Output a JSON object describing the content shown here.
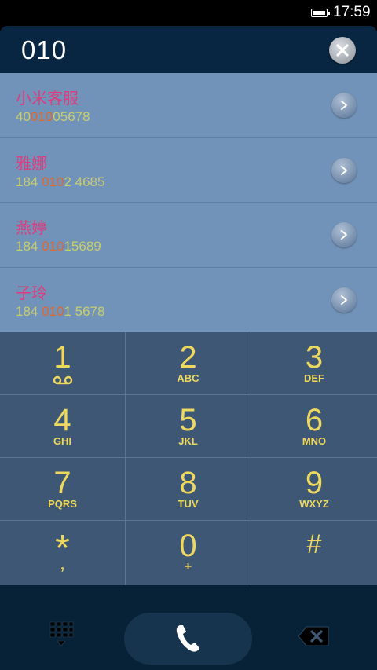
{
  "status_bar": {
    "time": "17:59"
  },
  "search": {
    "query": "010"
  },
  "results": [
    {
      "name": "小米客服",
      "number_parts": [
        "40",
        "010",
        "05678"
      ]
    },
    {
      "name": "雅娜",
      "number_parts": [
        "184 ",
        "010",
        "2 4685"
      ]
    },
    {
      "name": "燕婷",
      "number_parts": [
        "184 ",
        "010",
        "15689"
      ]
    },
    {
      "name": "子玲",
      "number_parts": [
        "184 ",
        "010",
        "1 5678"
      ]
    }
  ],
  "keypad": [
    {
      "digit": "1",
      "sub": "voicemail-icon"
    },
    {
      "digit": "2",
      "sub": "ABC"
    },
    {
      "digit": "3",
      "sub": "DEF"
    },
    {
      "digit": "4",
      "sub": "GHI"
    },
    {
      "digit": "5",
      "sub": "JKL"
    },
    {
      "digit": "6",
      "sub": "MNO"
    },
    {
      "digit": "7",
      "sub": "PQRS"
    },
    {
      "digit": "8",
      "sub": "TUV"
    },
    {
      "digit": "9",
      "sub": "WXYZ"
    },
    {
      "digit": "*",
      "sub": ","
    },
    {
      "digit": "0",
      "sub": "+"
    },
    {
      "digit": "#",
      "sub": ""
    }
  ],
  "colors": {
    "accent_yellow": "#eed95e",
    "name_pink": "#e03a7c",
    "number_olive": "#c8cd6c",
    "match_orange": "#e0672c",
    "results_bg": "#7293b9",
    "keypad_bg": "#3d5774",
    "header_bg": "#082642"
  }
}
